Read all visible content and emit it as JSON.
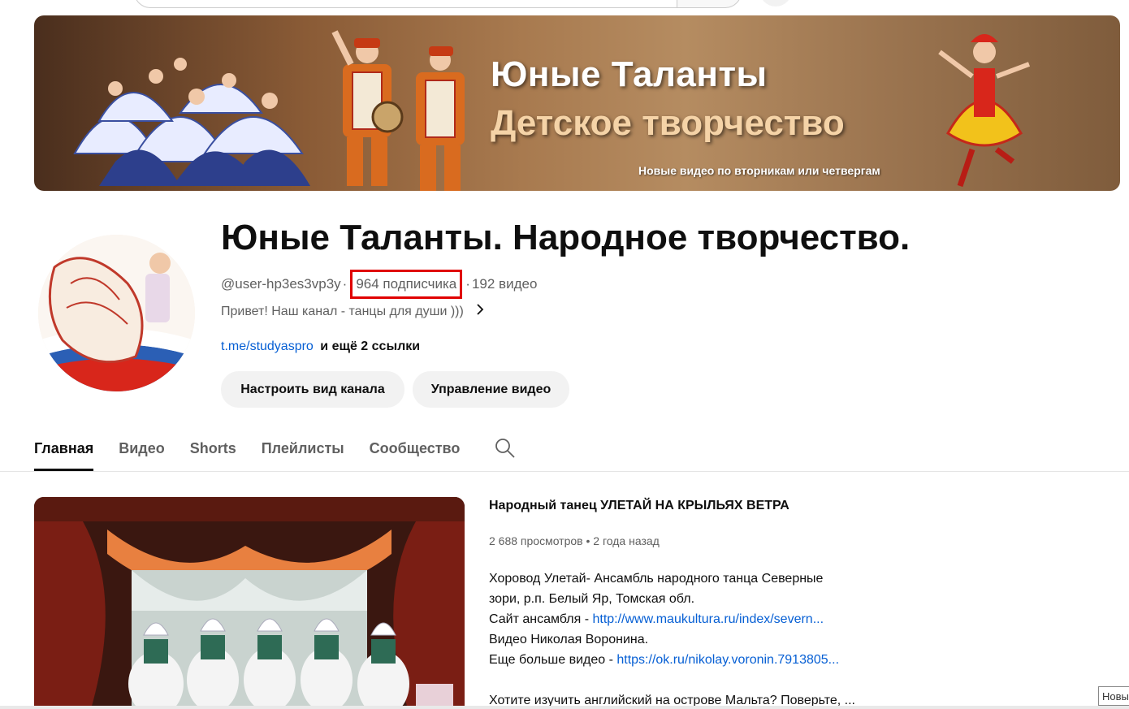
{
  "banner": {
    "title": "Юные Таланты",
    "subtitle": "Детское творчество",
    "note": "Новые видео по вторникам или четвергам"
  },
  "channel": {
    "name": "Юные Таланты. Народное творчество.",
    "handle": "@user-hp3es3vp3y",
    "separator": "·",
    "subscribers": "964 подписчика",
    "videos": "192 видео",
    "description": "Привет! Наш канал - танцы для души )))",
    "description_chevron": "›",
    "link": "t.me/studyaspro",
    "more_links": "и ещё 2 ссылки"
  },
  "buttons": {
    "customize": "Настроить вид канала",
    "manage": "Управление видео"
  },
  "tabs": [
    {
      "label": "Главная",
      "active": true
    },
    {
      "label": "Видео",
      "active": false
    },
    {
      "label": "Shorts",
      "active": false
    },
    {
      "label": "Плейлисты",
      "active": false
    },
    {
      "label": "Сообщество",
      "active": false
    }
  ],
  "featured": {
    "title": "Народный танец УЛЕТАЙ НА КРЫЛЬЯХ ВЕТРА",
    "views": "2 688 просмотров",
    "dot": "•",
    "age": "2 года назад",
    "desc": {
      "line1": "Хоровод Улетай- Ансамбль народного танца Северные",
      "line2": "зори, р.п. Белый Яр, Томская обл.",
      "line3_prefix": "Сайт ансамбля - ",
      "line3_link": "http://www.maukultura.ru/index/severn...",
      "line4": "Видео Николая Воронина.",
      "line5_prefix": "Еще больше видео - ",
      "line5_link": "https://ok.ru/nikolay.voronin.7913805...",
      "line6": "Хотите изучить английский на острове Мальта?  Поверьте, ..."
    }
  },
  "tooltip": "Новы",
  "colors": {
    "highlight": "#e00000",
    "link": "#065fd4",
    "text": "#0f0f0f",
    "secondary": "#606060"
  }
}
